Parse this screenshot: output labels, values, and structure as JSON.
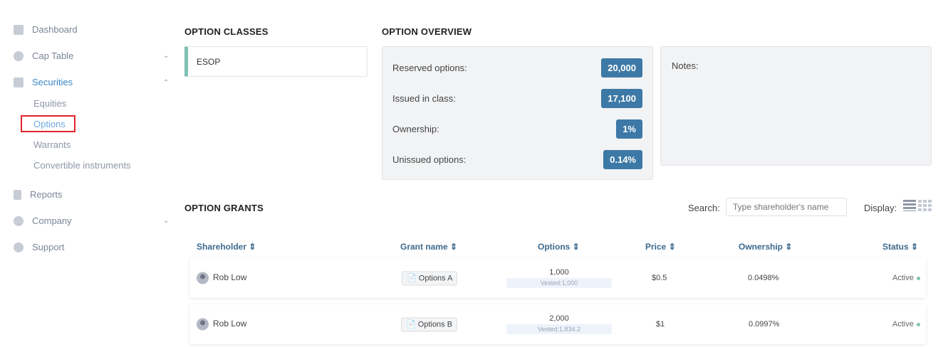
{
  "sidebar": {
    "items": [
      {
        "label": "Dashboard",
        "icon": "dashboard-icon"
      },
      {
        "label": "Cap Table",
        "icon": "pie-chart-icon",
        "chevron": "down"
      },
      {
        "label": "Securities",
        "icon": "clipboard-icon",
        "chevron": "up",
        "active": true
      },
      {
        "label": "Reports",
        "icon": "report-icon"
      },
      {
        "label": "Company",
        "icon": "flower-icon",
        "chevron": "down"
      },
      {
        "label": "Support",
        "icon": "support-icon"
      }
    ],
    "sub_items": [
      "Equities",
      "Options",
      "Warrants",
      "Convertible instruments"
    ],
    "selected_sub": "Options"
  },
  "classes": {
    "title": "OPTION CLASSES",
    "items": [
      "ESOP"
    ]
  },
  "overview": {
    "title": "OPTION OVERVIEW",
    "rows": [
      {
        "label": "Reserved options:",
        "value": "20,000"
      },
      {
        "label": "Issued in class:",
        "value": "17,100"
      },
      {
        "label": "Ownership:",
        "value": "1%"
      },
      {
        "label": "Unissued options:",
        "value": "0.14%"
      }
    ],
    "notes_label": "Notes:"
  },
  "grants": {
    "title": "OPTION GRANTS",
    "search_label": "Search:",
    "search_placeholder": "Type shareholder's name",
    "display_label": "Display:",
    "columns": [
      "Shareholder",
      "Grant name",
      "Options",
      "Price",
      "Ownership",
      "Status"
    ],
    "rows": [
      {
        "shareholder": "Rob Low",
        "grant": "Options A",
        "options": "1,000",
        "vested": "Vested:1,000",
        "price": "$0.5",
        "ownership": "0.0498%",
        "status": "Active"
      },
      {
        "shareholder": "Rob Low",
        "grant": "Options B",
        "options": "2,000",
        "vested": "Vested:1,834.2",
        "price": "$1",
        "ownership": "0.0997%",
        "status": "Active"
      }
    ]
  },
  "colors": {
    "accent": "#3d79a6",
    "active_nav": "#3d86c6",
    "status_active": "#7cc4a8",
    "class_marker": "#7fc1b4"
  }
}
